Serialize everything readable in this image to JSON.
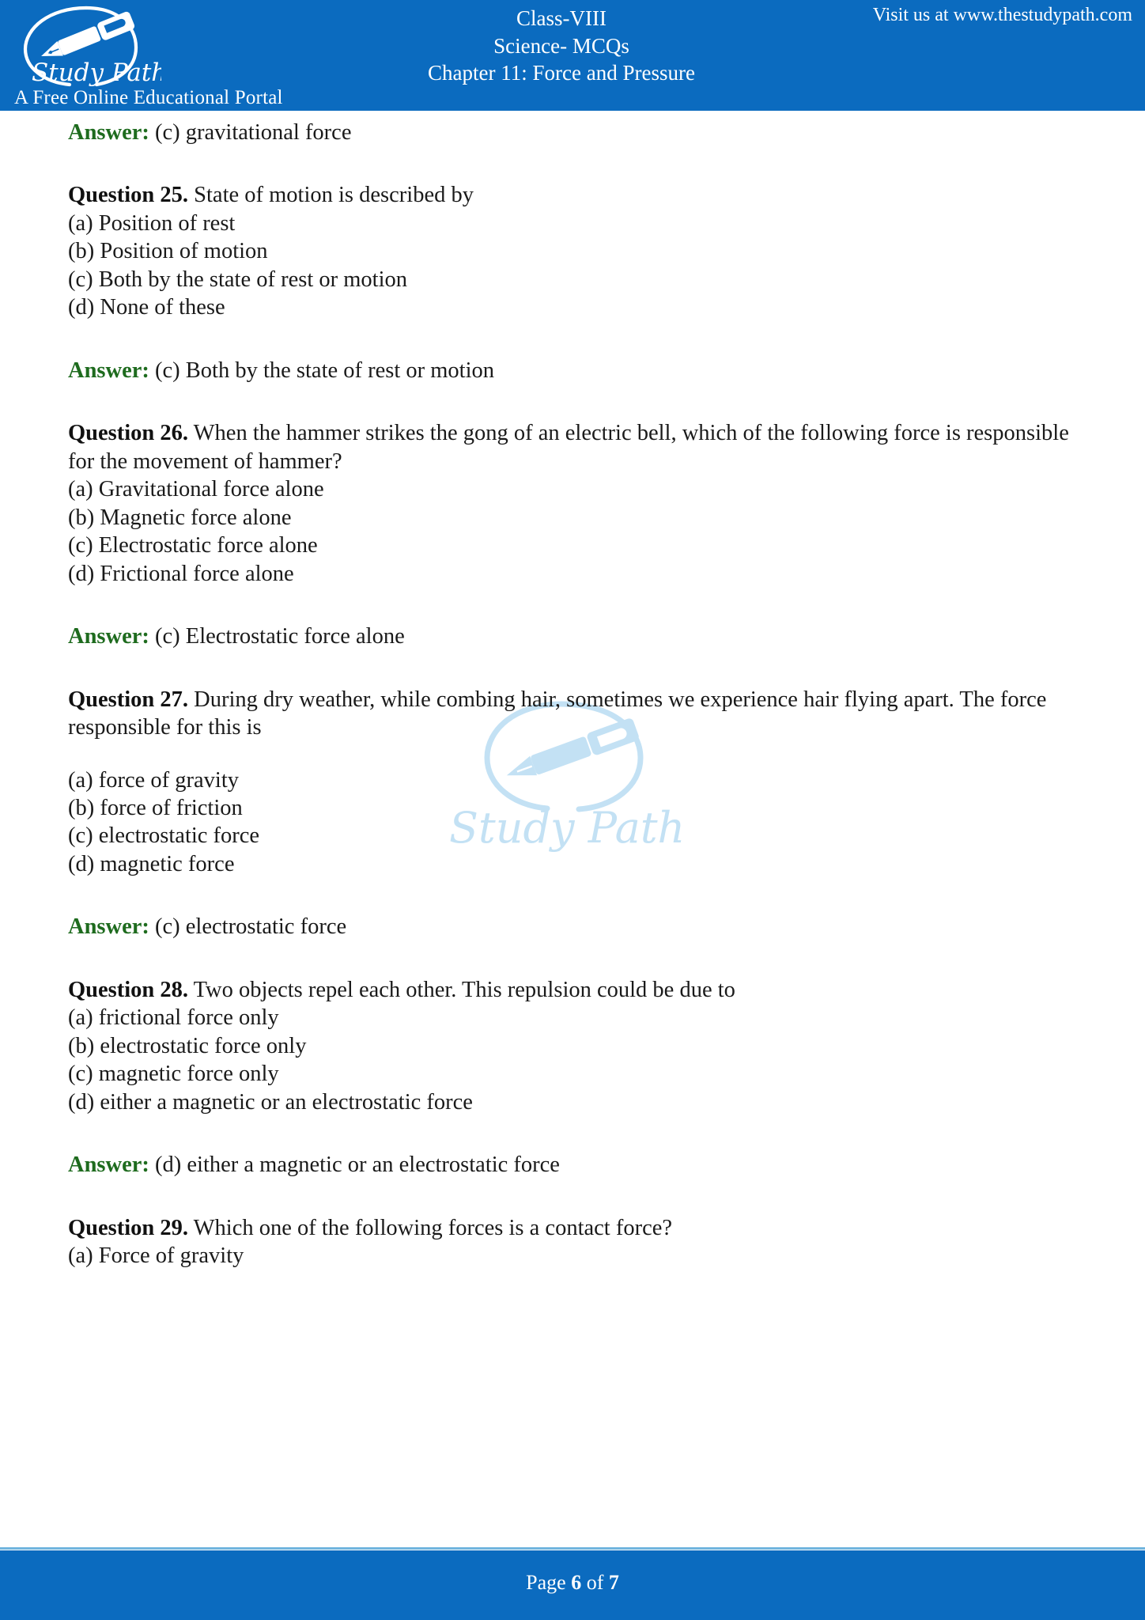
{
  "colors": {
    "header_blue": "#0B6BBF",
    "footer_blue": "#0B6BBF",
    "answer_green": "#1E6B1E",
    "watermark_blue": "#9FD0EE",
    "body_text": "#1a1a1a"
  },
  "header": {
    "logo_text": "Study Path",
    "tagline": "A Free Online Educational Portal",
    "line1": "Class-VIII",
    "line2": "Science- MCQs",
    "line3": "Chapter 11: Force and Pressure",
    "visit": "Visit us at www.thestudypath.com"
  },
  "watermark": {
    "text": "Study Path"
  },
  "body": {
    "answer_label": "Answer:",
    "question_labels": {
      "q25": "Question 25.",
      "q26": "Question 26.",
      "q27": "Question 27.",
      "q28": "Question 28.",
      "q29": "Question 29."
    },
    "answer_24_text": " (c) gravitational force",
    "q25": {
      "text": " State of motion is described by",
      "options": [
        "(a) Position of rest",
        "(b) Position of motion",
        "(c) Both by the state of rest or motion",
        "(d) None of these"
      ],
      "answer": " (c) Both by the state of rest or motion"
    },
    "q26": {
      "text": " When the hammer strikes the gong of an electric bell, which of the following force is responsible for the movement of hammer?",
      "options": [
        "(a) Gravitational force alone",
        "(b) Magnetic force alone",
        "(c) Electrostatic force alone",
        "(d) Frictional force alone"
      ],
      "answer": " (c) Electrostatic force alone"
    },
    "q27": {
      "text": " During dry weather, while combing hair, sometimes we experience hair flying apart. The force responsible for this is",
      "options": [
        "(a) force of gravity",
        "(b) force of friction",
        "(c) electrostatic force",
        "(d) magnetic force"
      ],
      "answer": " (c) electrostatic force"
    },
    "q28": {
      "text": " Two objects repel each other. This repulsion could be due to",
      "options": [
        "(a) frictional force only",
        "(b) electrostatic force only",
        "(c) magnetic force only",
        "(d) either a magnetic or an electrostatic force"
      ],
      "answer": " (d) either a magnetic or an electrostatic force"
    },
    "q29": {
      "text": " Which one of the following forces is a contact force?",
      "options": [
        "(a) Force of gravity"
      ]
    }
  },
  "footer": {
    "prefix": "Page ",
    "current": "6",
    "middle": " of ",
    "total": "7"
  }
}
